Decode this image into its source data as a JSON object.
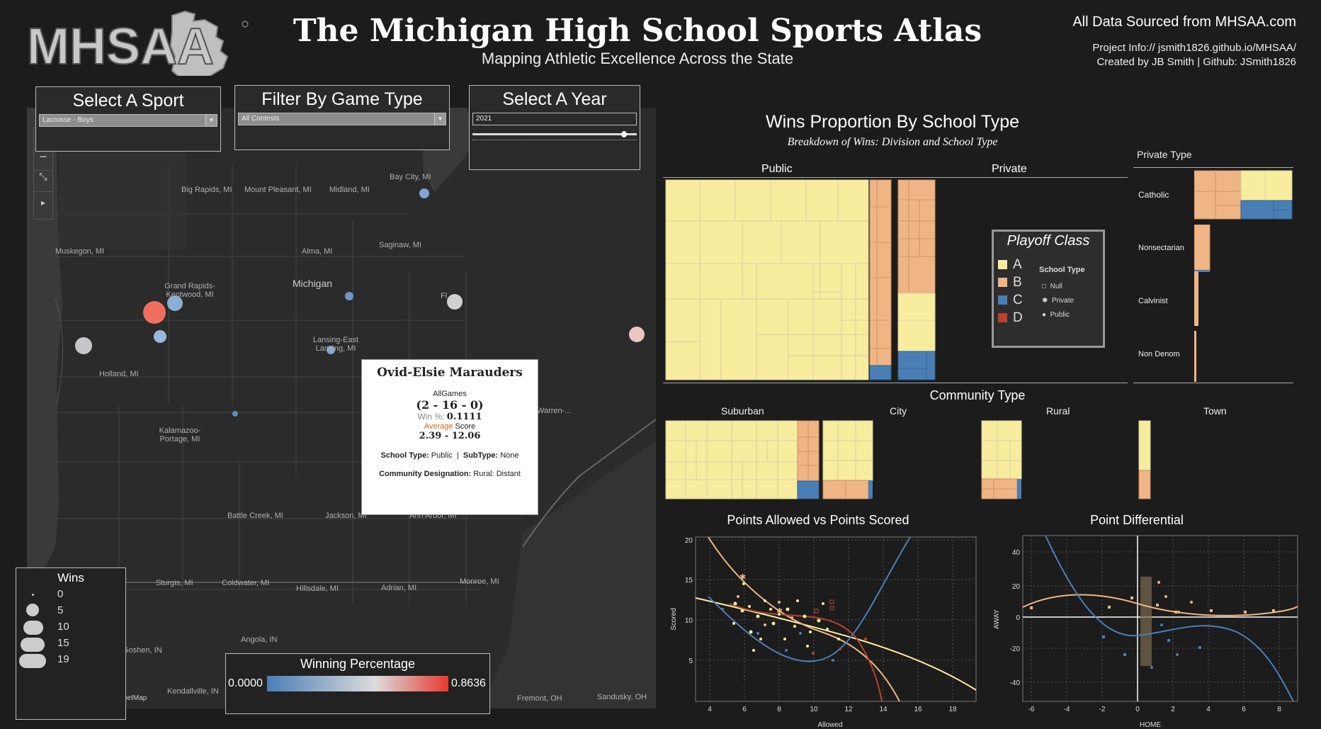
{
  "header": {
    "title": "The Michigan High School Sports Atlas",
    "subtitle": "Mapping Athletic Excellence Across the State",
    "source": "All Data Sourced from MHSAA.com",
    "project_info": "Project Info:// jsmith1826.github.io/MHSAA/",
    "credits": "Created by JB Smith | Github: JSmith1826",
    "logo_text": "MHSAA"
  },
  "filters": {
    "sport": {
      "title": "Select A Sport",
      "value": "Lacrosse - Boys"
    },
    "game_type": {
      "title": "Filter By Game Type",
      "value": "All Contests"
    },
    "year": {
      "title": "Select A Year",
      "value": "2021"
    }
  },
  "map": {
    "attribution": "eetMap",
    "center_label": "Michigan",
    "cities": [
      "Bay City, MI",
      "Big Rapids, MI",
      "Mount Pleasant, MI",
      "Midland, MI",
      "Muskegon, MI",
      "Saginaw, MI",
      "Alma, MI",
      "Grand Rapids-Kentwood, MI",
      "Holland, MI",
      "Lansing-East Lansing, MI",
      "Kalamazoo-Portage, MI",
      "Battle Creek, MI",
      "Jackson, MI",
      "Ann Arbor, MI",
      "Sturgis, MI",
      "Coldwater, MI",
      "Hillsdale, MI",
      "Adrian, MI",
      "Monroe, MI",
      "Angola, IN",
      "Goshen, IN",
      "Kendallville, IN",
      "Fremont, OH",
      "Sandusky, OH",
      "Warren-...",
      "Fl..."
    ]
  },
  "tooltip": {
    "team": "Ovid-Elsie Marauders",
    "games_label": "AllGames",
    "record": "(2 - 16 - 0)",
    "winpct_label": "Win %:",
    "winpct": "0.1111",
    "avg_label_1": "Average",
    "avg_label_2": "Score",
    "avg_score": "2.39 -  12.06",
    "school_type_label": "School Type:",
    "school_type": "Public",
    "subtype_label": "SubType:",
    "subtype": "None",
    "community_label": "Community Designation:",
    "community": "Rural: Distant"
  },
  "wins_legend": {
    "title": "Wins",
    "items": [
      "0",
      "5",
      "10",
      "15",
      "19"
    ]
  },
  "winpct_legend": {
    "title": "Winning Percentage",
    "min": "0.0000",
    "max": "0.8636"
  },
  "treemap": {
    "title": "Wins Proportion By School Type",
    "subtitle": "Breakdown of Wins: Division and School Type",
    "public_label": "Public",
    "private_label": "Private",
    "private_type_title": "Private Type",
    "private_types": [
      "Catholic",
      "Nonsectarian",
      "Calvinist",
      "Non Denom"
    ],
    "community_title": "Community Type",
    "community_types": [
      "Suburban",
      "City",
      "Rural",
      "Town"
    ]
  },
  "class_legend": {
    "title": "Playoff Class",
    "classes": [
      {
        "label": "A",
        "color": "#f8ec9e"
      },
      {
        "label": "B",
        "color": "#efb584"
      },
      {
        "label": "C",
        "color": "#4a7fb5"
      },
      {
        "label": "D",
        "color": "#b8432f"
      }
    ],
    "school_type_title": "School Type",
    "school_types": [
      "Null",
      "Private",
      "Public"
    ]
  },
  "scatter1": {
    "title": "Points Allowed vs Points Scored",
    "xlabel": "Allowed",
    "ylabel": "Scored",
    "xticks": [
      "4",
      "6",
      "8",
      "10",
      "12",
      "14",
      "16",
      "18"
    ],
    "yticks": [
      "20",
      "15",
      "10",
      "5"
    ]
  },
  "scatter2": {
    "title": "Point Differential",
    "xlabel": "HOME",
    "ylabel": "AWAY",
    "xticks": [
      "-6",
      "-4",
      "-2",
      "0",
      "2",
      "4",
      "6",
      "8"
    ],
    "yticks": [
      "40",
      "20",
      "0",
      "-20",
      "-40"
    ]
  },
  "colors": {
    "background": "#1c1c1c",
    "class_a": "#f8ec9e",
    "class_b": "#efb584",
    "class_c": "#4a7fb5",
    "class_d": "#b8432f",
    "win_low": "#4a7fb5",
    "win_high": "#e8392e"
  }
}
